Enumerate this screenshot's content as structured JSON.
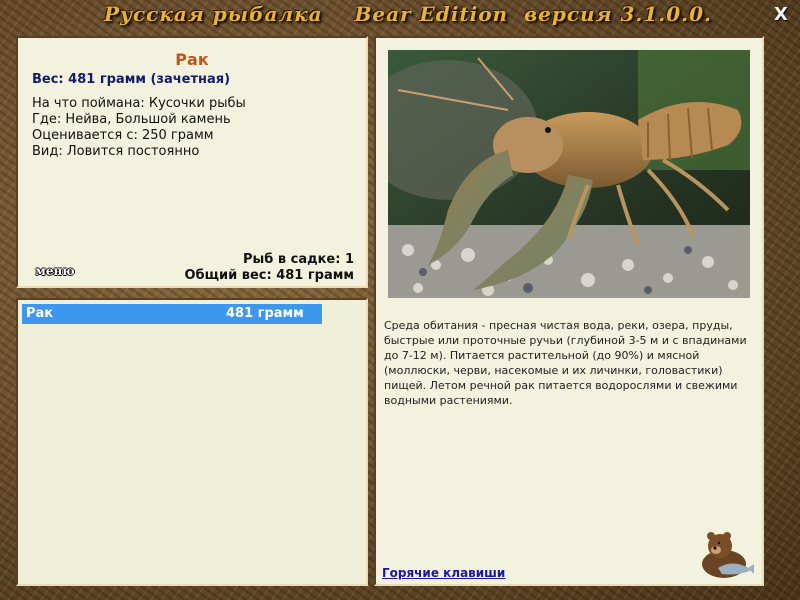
{
  "window": {
    "title": "Русская рыбалка    Bear Edition  версия 3.1.0.0.",
    "close_label": "X"
  },
  "catch_info": {
    "name": "Рак",
    "weight_line": "Вес: 481 грамм (зачетная)",
    "details": [
      "На что поймана: Кусочки рыбы",
      "Где: Нейва, Большой камень",
      "Оценивается с: 250 грамм",
      "Вид: Ловится постоянно"
    ],
    "menu_label": "меню",
    "fish_in_keepnet": "Рыб в садке: 1",
    "total_weight": "Общий вес: 481 грамм"
  },
  "keepnet": {
    "rows": [
      {
        "name": "Рак",
        "weight": "481 грамм",
        "selected": true
      }
    ]
  },
  "species_info": {
    "photo_subject": "crayfish",
    "description": "Среда обитания - пресная чистая вода, реки, озера, пруды, быстрые или проточные ручьи (глубиной 3-5 м и с впадинами до 7-12 м). Питается растительной (до 90%) и мясной (моллюски, черви, насекомые и их личинки, головастики) пищей. Летом речной рак питается водорослями и свежими водными растениями.",
    "hotkeys_label": "Горячие клавиши"
  },
  "colors": {
    "title": "#e8b13a",
    "fish_name": "#c05718",
    "weight": "#141a6c",
    "selection": "#3d97ee",
    "link": "#1a1aa0"
  }
}
